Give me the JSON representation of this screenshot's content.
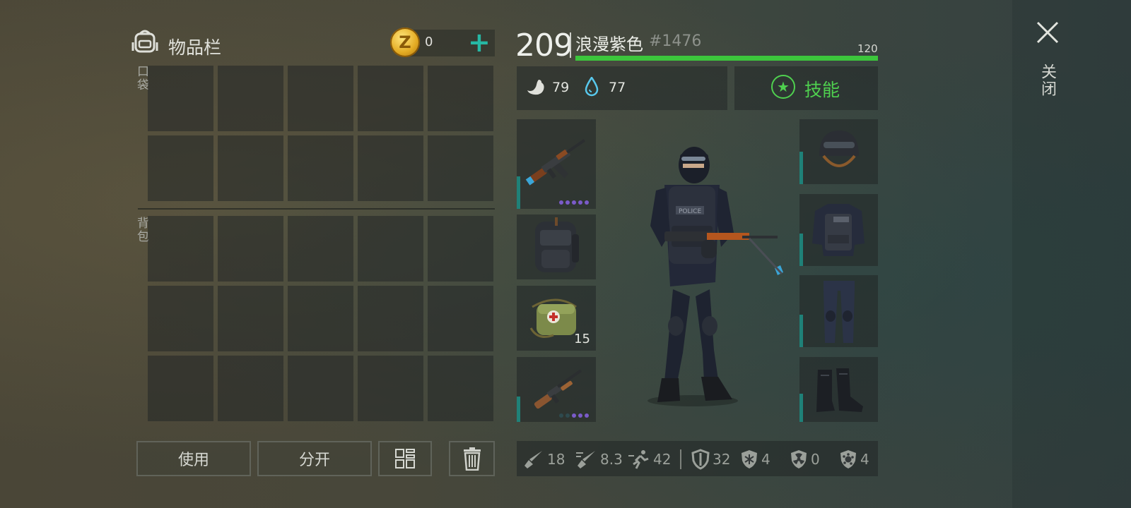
{
  "inventory": {
    "title": "物品栏",
    "coins": "0",
    "coin_symbol": "Z",
    "pocket_label": "口袋",
    "backpack_label": "背包",
    "pocket_slots": 10,
    "backpack_slots": 15,
    "buttons": {
      "use": "使用",
      "split": "分开"
    }
  },
  "character": {
    "level": "209",
    "name": "浪漫紫色",
    "id": "#1476",
    "hp": "120",
    "hp_fraction": 1.0,
    "hunger": "79",
    "thirst": "77",
    "skills_label": "技能"
  },
  "equipment": {
    "medkit_count": "15"
  },
  "stats": [
    {
      "icon": "melee-damage-icon",
      "value": "18"
    },
    {
      "icon": "attack-speed-icon",
      "value": "8.3"
    },
    {
      "icon": "movement-speed-icon",
      "value": "42"
    },
    {
      "icon": "armor-icon",
      "value": "32"
    },
    {
      "icon": "cold-resistance-icon",
      "value": "4"
    },
    {
      "icon": "radiation-resistance-icon",
      "value": "0"
    },
    {
      "icon": "infection-resistance-icon",
      "value": "4"
    }
  ],
  "close_label": "关闭",
  "colors": {
    "accent_green": "#4fd04f",
    "teal": "#26b7a4",
    "rarity_purple": "#7b5bc9"
  }
}
